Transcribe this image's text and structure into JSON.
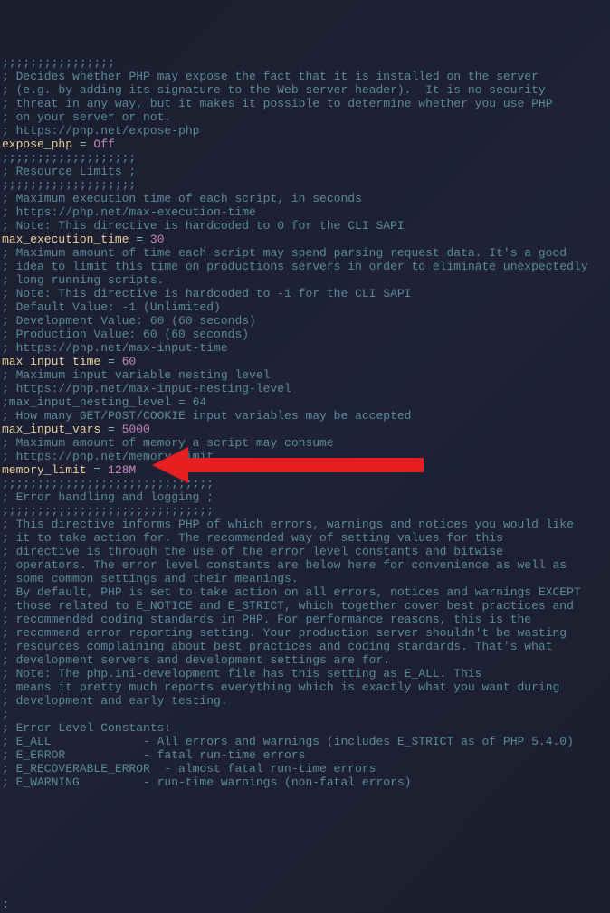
{
  "lines": [
    {
      "t": "comment",
      "text": ";;;;;;;;;;;;;;;;"
    },
    {
      "t": "blank",
      "text": ""
    },
    {
      "t": "comment",
      "text": "; Decides whether PHP may expose the fact that it is installed on the server"
    },
    {
      "t": "comment",
      "text": "; (e.g. by adding its signature to the Web server header).  It is no security"
    },
    {
      "t": "comment",
      "text": "; threat in any way, but it makes it possible to determine whether you use PHP"
    },
    {
      "t": "comment",
      "text": "; on your server or not."
    },
    {
      "t": "comment",
      "text": "; https://php.net/expose-php"
    },
    {
      "t": "kv",
      "key": "expose_php",
      "val": "Off",
      "vclass": "val-off"
    },
    {
      "t": "blank",
      "text": ""
    },
    {
      "t": "comment",
      "text": ";;;;;;;;;;;;;;;;;;;"
    },
    {
      "t": "comment",
      "text": "; Resource Limits ;"
    },
    {
      "t": "comment",
      "text": ";;;;;;;;;;;;;;;;;;;"
    },
    {
      "t": "blank",
      "text": ""
    },
    {
      "t": "comment",
      "text": "; Maximum execution time of each script, in seconds"
    },
    {
      "t": "comment",
      "text": "; https://php.net/max-execution-time"
    },
    {
      "t": "comment",
      "text": "; Note: This directive is hardcoded to 0 for the CLI SAPI"
    },
    {
      "t": "kv",
      "key": "max_execution_time",
      "val": "30",
      "vclass": "val-num"
    },
    {
      "t": "blank",
      "text": ""
    },
    {
      "t": "comment",
      "text": "; Maximum amount of time each script may spend parsing request data. It's a good"
    },
    {
      "t": "comment",
      "text": "; idea to limit this time on productions servers in order to eliminate unexpectedly"
    },
    {
      "t": "comment",
      "text": "; long running scripts."
    },
    {
      "t": "comment",
      "text": "; Note: This directive is hardcoded to -1 for the CLI SAPI"
    },
    {
      "t": "comment",
      "text": "; Default Value: -1 (Unlimited)"
    },
    {
      "t": "comment",
      "text": "; Development Value: 60 (60 seconds)"
    },
    {
      "t": "comment",
      "text": "; Production Value: 60 (60 seconds)"
    },
    {
      "t": "comment",
      "text": "; https://php.net/max-input-time"
    },
    {
      "t": "kv",
      "key": "max_input_time",
      "val": "60",
      "vclass": "val-num"
    },
    {
      "t": "blank",
      "text": ""
    },
    {
      "t": "comment",
      "text": "; Maximum input variable nesting level"
    },
    {
      "t": "comment",
      "text": "; https://php.net/max-input-nesting-level"
    },
    {
      "t": "comment",
      "text": ";max_input_nesting_level = 64"
    },
    {
      "t": "blank",
      "text": ""
    },
    {
      "t": "comment",
      "text": "; How many GET/POST/COOKIE input variables may be accepted"
    },
    {
      "t": "kv",
      "key": "max_input_vars",
      "val": "5000",
      "vclass": "val-num"
    },
    {
      "t": "blank",
      "text": ""
    },
    {
      "t": "comment",
      "text": "; Maximum amount of memory a script may consume"
    },
    {
      "t": "comment",
      "text": "; https://php.net/memory-limit"
    },
    {
      "t": "kv",
      "key": "memory_limit",
      "val": "128M",
      "vclass": "val-num"
    },
    {
      "t": "blank",
      "text": ""
    },
    {
      "t": "comment",
      "text": ";;;;;;;;;;;;;;;;;;;;;;;;;;;;;;"
    },
    {
      "t": "comment",
      "text": "; Error handling and logging ;"
    },
    {
      "t": "comment",
      "text": ";;;;;;;;;;;;;;;;;;;;;;;;;;;;;;"
    },
    {
      "t": "blank",
      "text": ""
    },
    {
      "t": "comment",
      "text": "; This directive informs PHP of which errors, warnings and notices you would like"
    },
    {
      "t": "comment",
      "text": "; it to take action for. The recommended way of setting values for this"
    },
    {
      "t": "comment",
      "text": "; directive is through the use of the error level constants and bitwise"
    },
    {
      "t": "comment",
      "text": "; operators. The error level constants are below here for convenience as well as"
    },
    {
      "t": "comment",
      "text": "; some common settings and their meanings."
    },
    {
      "t": "comment",
      "text": "; By default, PHP is set to take action on all errors, notices and warnings EXCEPT"
    },
    {
      "t": "comment",
      "text": "; those related to E_NOTICE and E_STRICT, which together cover best practices and"
    },
    {
      "t": "comment",
      "text": "; recommended coding standards in PHP. For performance reasons, this is the"
    },
    {
      "t": "comment",
      "text": "; recommend error reporting setting. Your production server shouldn't be wasting"
    },
    {
      "t": "comment",
      "text": "; resources complaining about best practices and coding standards. That's what"
    },
    {
      "t": "comment",
      "text": "; development servers and development settings are for."
    },
    {
      "t": "comment",
      "text": "; Note: The php.ini-development file has this setting as E_ALL. This"
    },
    {
      "t": "comment",
      "text": "; means it pretty much reports everything which is exactly what you want during"
    },
    {
      "t": "comment",
      "text": "; development and early testing."
    },
    {
      "t": "comment",
      "text": ";"
    },
    {
      "t": "comment",
      "text": "; Error Level Constants:"
    },
    {
      "t": "comment",
      "text": "; E_ALL             - All errors and warnings (includes E_STRICT as of PHP 5.4.0)"
    },
    {
      "t": "comment",
      "text": "; E_ERROR           - fatal run-time errors"
    },
    {
      "t": "comment",
      "text": "; E_RECOVERABLE_ERROR  - almost fatal run-time errors"
    },
    {
      "t": "comment",
      "text": "; E_WARNING         - run-time warnings (non-fatal errors)"
    }
  ],
  "status": ":",
  "arrow_color": "#e62020"
}
